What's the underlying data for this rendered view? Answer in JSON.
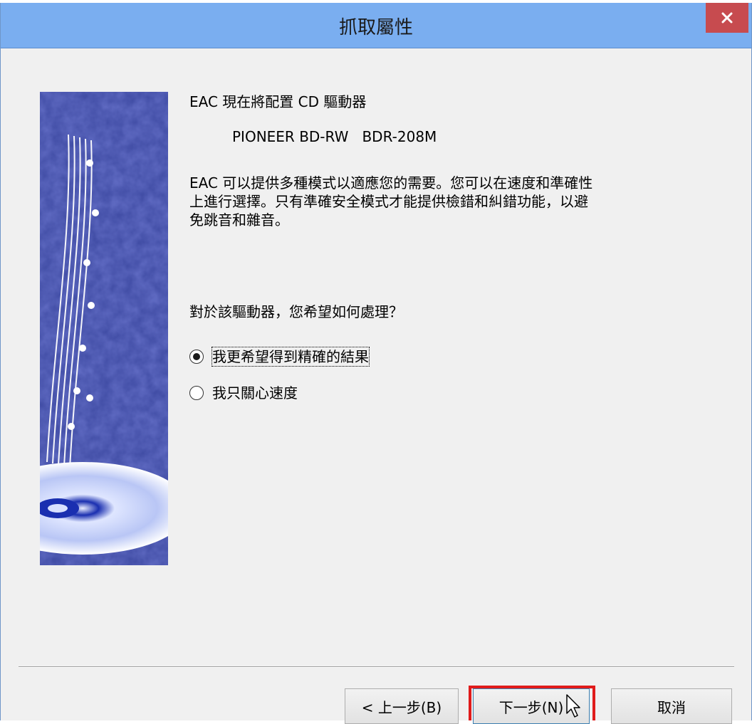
{
  "window": {
    "title": "抓取屬性"
  },
  "content": {
    "heading": "EAC 現在將配置 CD 驅動器",
    "drive_name": "PIONEER BD-RW   BDR-208M",
    "description": "EAC 可以提供多種模式以適應您的需要。您可以在速度和準確性\n上進行選擇。只有準確安全模式才能提供檢錯和糾錯功能，以避\n免跳音和雜音。",
    "question": "對於該驅動器，您希望如何處理？",
    "options": [
      {
        "label": "我更希望得到精確的結果",
        "selected": true
      },
      {
        "label": "我只關心速度",
        "selected": false
      }
    ]
  },
  "buttons": {
    "back": "< 上一步(B)",
    "next": "下一步(N)",
    "cancel": "取消"
  },
  "colors": {
    "titlebar": "#7aaef0",
    "close": "#c74b4f",
    "highlight": "#e01b1b",
    "background": "#f0f0f0"
  }
}
